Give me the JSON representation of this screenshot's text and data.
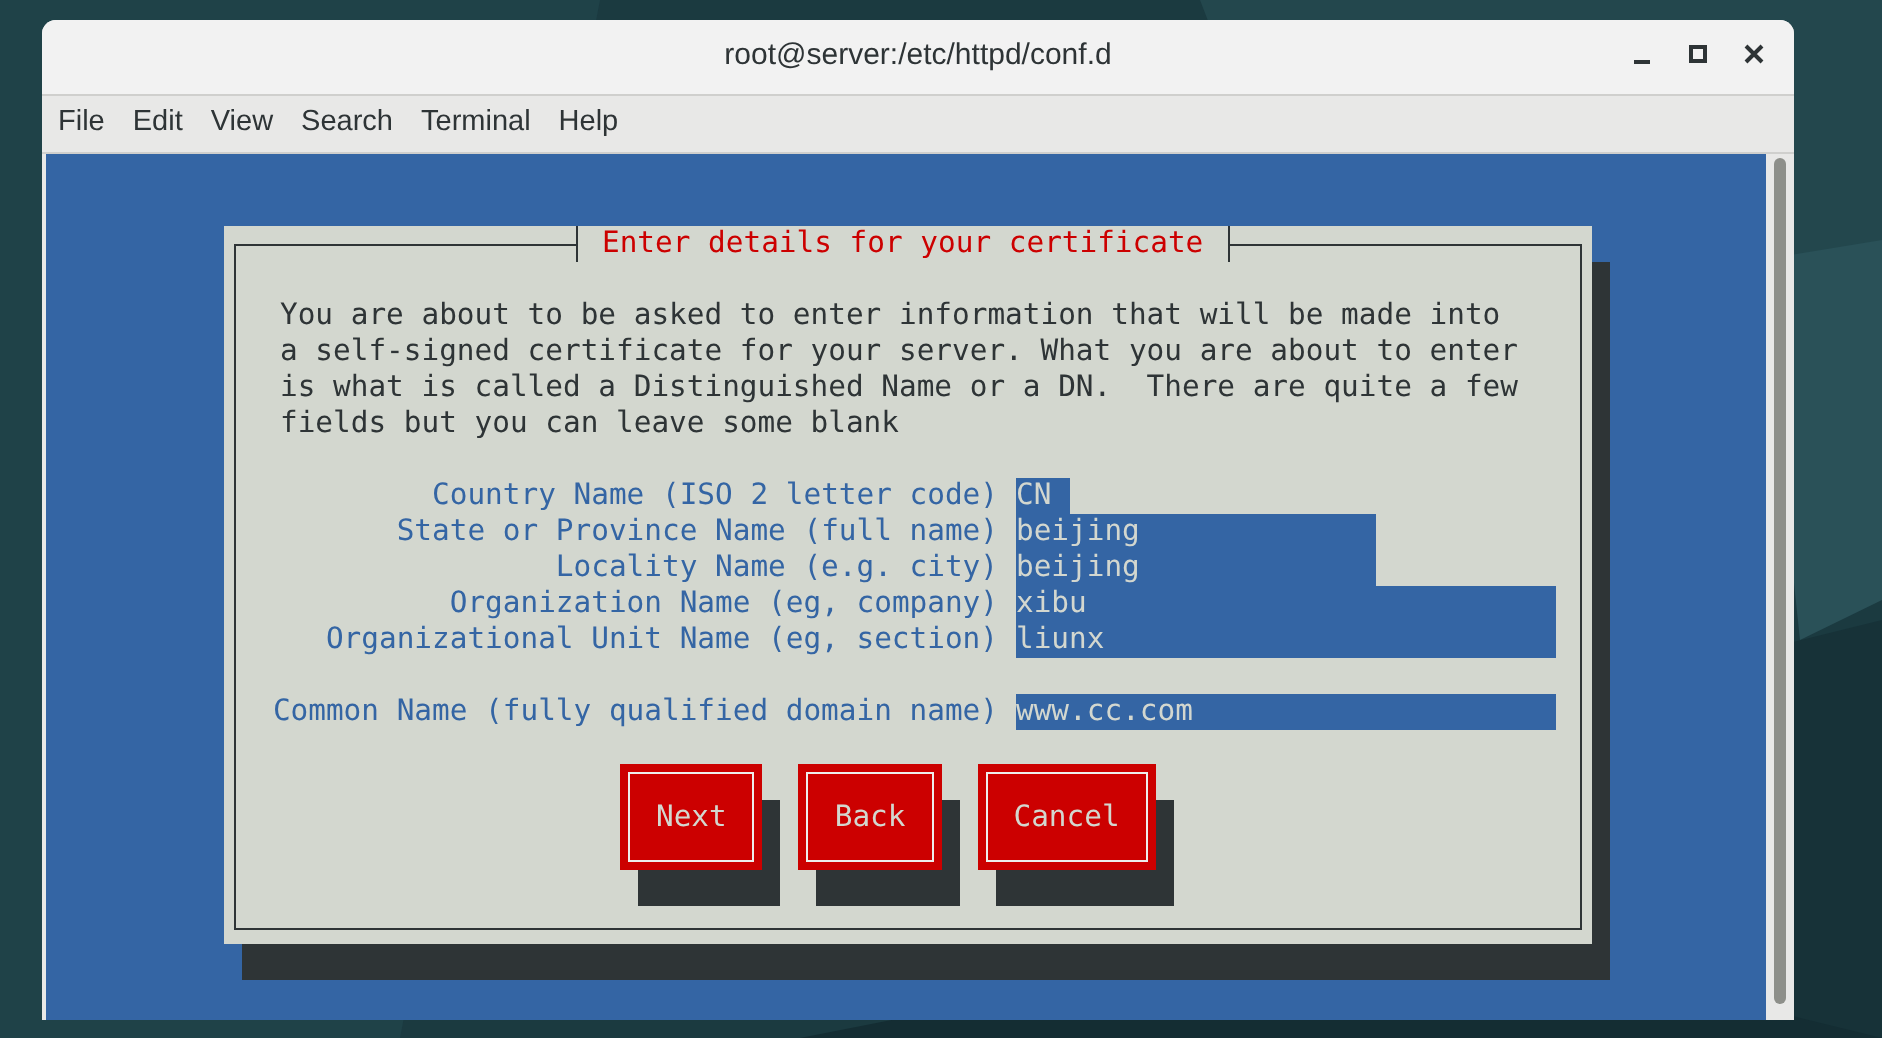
{
  "window": {
    "title": "root@server:/etc/httpd/conf.d"
  },
  "menu": [
    "File",
    "Edit",
    "View",
    "Search",
    "Terminal",
    "Help"
  ],
  "dialog": {
    "title": "Enter details for your certificate",
    "message": [
      "You are about to be asked to enter information that will be made into",
      "a self-signed certificate for your server. What you are about to enter",
      "is what is called a Distinguished Name or a DN.  There are quite a few",
      "fields but you can leave some blank"
    ],
    "fields": [
      {
        "label": "Country Name (ISO 2 letter code)",
        "value": "CN"
      },
      {
        "label": "State or Province Name (full name)",
        "value": "beijing"
      },
      {
        "label": "Locality Name (e.g. city)",
        "value": "beijing"
      },
      {
        "label": "Organization Name (eg, company)",
        "value": "xibu"
      },
      {
        "label": "Organizational Unit Name (eg, section)",
        "value": "liunx"
      },
      {
        "label": "Common Name (fully qualified domain name)",
        "value": "www.cc.com"
      }
    ],
    "buttons": [
      "Next",
      "Back",
      "Cancel"
    ]
  }
}
